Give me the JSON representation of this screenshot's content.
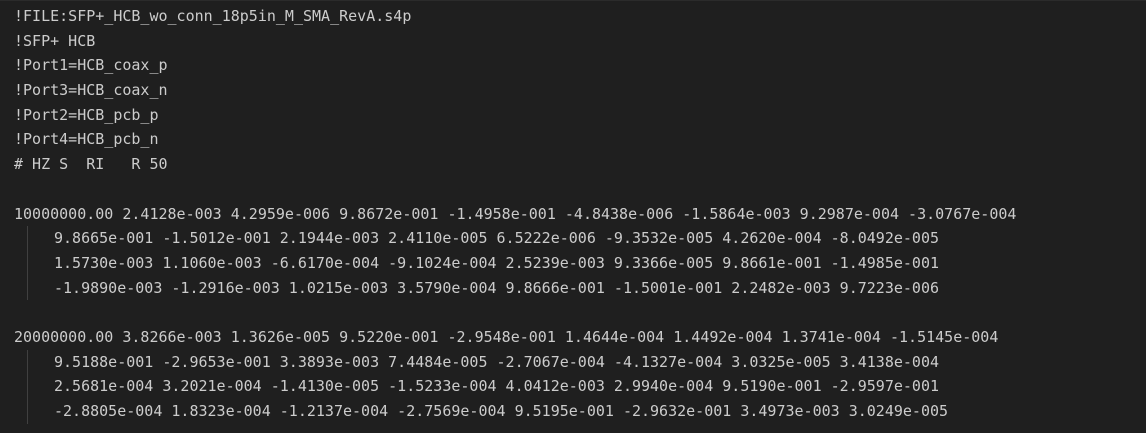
{
  "editor": {
    "header_lines": [
      "!FILE:SFP+_HCB_wo_conn_18p5in_M_SMA_RevA.s4p",
      "!SFP+ HCB",
      "!Port1=HCB_coax_p",
      "!Port3=HCB_coax_n",
      "!Port2=HCB_pcb_p",
      "!Port4=HCB_pcb_n",
      "# HZ S  RI   R 50"
    ],
    "blocks": [
      {
        "first_line": "10000000.00 2.4128e-003 4.2959e-006 9.8672e-001 -1.4958e-001 -4.8438e-006 -1.5864e-003 9.2987e-004 -3.0767e-004",
        "continuation_lines": [
          "9.8665e-001 -1.5012e-001 2.1944e-003 2.4110e-005 6.5222e-006 -9.3532e-005 4.2620e-004 -8.0492e-005",
          "1.5730e-003 1.1060e-003 -6.6170e-004 -9.1024e-004 2.5239e-003 9.3366e-005 9.8661e-001 -1.4985e-001",
          "-1.9890e-003 -1.2916e-003 1.0215e-003 3.5790e-004 9.8666e-001 -1.5001e-001 2.2482e-003 9.7223e-006"
        ]
      },
      {
        "first_line": "20000000.00 3.8266e-003 1.3626e-005 9.5220e-001 -2.9548e-001 1.4644e-004 1.4492e-004 1.3741e-004 -1.5145e-004",
        "continuation_lines": [
          "9.5188e-001 -2.9653e-001 3.3893e-003 7.4484e-005 -2.7067e-004 -4.1327e-004 3.0325e-005 3.4138e-004",
          "2.5681e-004 3.2021e-004 -1.4130e-005 -1.5233e-004 4.0412e-003 2.9940e-004 9.5190e-001 -2.9597e-001",
          "-2.8805e-004 1.8323e-004 -1.2137e-004 -2.7569e-004 9.5195e-001 -2.9632e-001 3.4973e-003 3.0249e-005"
        ]
      }
    ],
    "colors": {
      "background": "#1f1f1f",
      "text": "#cccccc",
      "indent_guide": "#404040"
    }
  }
}
